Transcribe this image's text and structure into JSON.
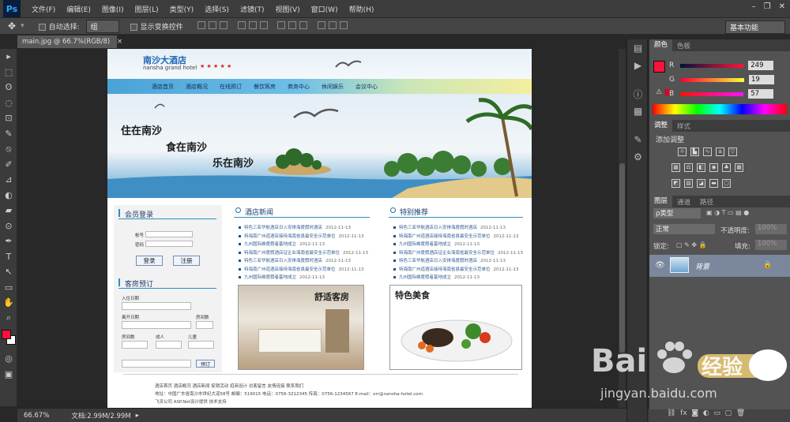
{
  "menubar": {
    "logo": "Ps",
    "items": [
      "文件(F)",
      "编辑(E)",
      "图像(I)",
      "图层(L)",
      "类型(Y)",
      "选择(S)",
      "滤镜(T)",
      "视图(V)",
      "窗口(W)",
      "帮助(H)"
    ],
    "minimize": "–",
    "restore": "❐",
    "close": "✕"
  },
  "options": {
    "tool_icon": "✥",
    "auto_select_label": "自动选择:",
    "auto_select_value": "组",
    "show_transform_label": "显示变换控件",
    "workspace": "基本功能"
  },
  "document": {
    "tab_label": "main.jpg @ 66.7%(RGB/8)",
    "tab_close": "×"
  },
  "status": {
    "zoom": "66.67%",
    "doc_size": "文档:2.99M/2.99M"
  },
  "tools": [
    "▸",
    "⬚",
    "ʘ",
    "◌",
    "⊡",
    "✎",
    "⦸",
    "✐",
    "⊿",
    "◐",
    "▰",
    "⊙",
    "✒",
    "T",
    "↖",
    "▭",
    "✋",
    "⌕"
  ],
  "panels": {
    "color_tab": "颜色",
    "swatches_tab": "色板",
    "r_label": "R",
    "g_label": "G",
    "b_label": "B",
    "r_value": "249",
    "g_value": "19",
    "b_value": "57",
    "foreground_color": "#f91339",
    "adjust_tab": "调整",
    "styles_tab": "样式",
    "add_adjust": "添加调整",
    "layers_tab": "图层",
    "channels_tab": "通道",
    "paths_tab": "路径",
    "kind_label": "ρ类型",
    "blend_mode": "正常",
    "opacity_label": "不透明度:",
    "opacity_value": "100%",
    "lock_label": "锁定:",
    "fill_label": "填充:",
    "fill_value": "100%",
    "layer_name": "背景"
  },
  "hotel": {
    "logo_cn": "南沙大酒店",
    "logo_en": "nansha grand hotel",
    "stars": "★ ★ ★ ★ ★",
    "nav": [
      "酒店首页",
      "酒店概况",
      "在线预订",
      "餐饮客房",
      "商务中心",
      "休闲娱乐",
      "会议中心"
    ],
    "slogan1": "住在南沙",
    "slogan2": "食在南沙",
    "slogan3": "乐在南沙",
    "login_title": "会员登录",
    "account_label": "帐号",
    "password_label": "密码",
    "login_btn": "登录",
    "register_btn": "注册",
    "booking_title": "客房预订",
    "checkin_label": "入住日期",
    "checkout_label": "离开日期",
    "room_count_label": "房间数",
    "room_type_label": "房间数",
    "adult_label": "成人",
    "child_label": "儿童",
    "note_label": "",
    "book_btn": "预订",
    "news_title": "酒店新闻",
    "recommend_title": "特别推荐",
    "news": [
      "特色三亚华航酒店日入安排海度假时酒店",
      "特海南广州道酒店接待海南省县最安全示范单位",
      "九州国际维度假者基地成立",
      "特海南广州度假酒店证企业海南省最安全示范单位",
      "特色三亚华航酒店日入安排海度假时酒店",
      "特海南广州道酒店接待海南省县最安全示范单位",
      "九州国际维度假者基地成立"
    ],
    "recommend": [
      "特色三亚华航酒店日入安排海度假时酒店",
      "特海南广州道酒店接待海南省县最安全示范单位",
      "九州国际维度假者基地成立",
      "特海南广州度假酒店证企业海南省最安全示范单位",
      "特色三亚华航酒店日入安排海度假时酒店",
      "特海南广州道酒店接待海南省县最安全示范单位",
      "九州国际维度假者基地成立"
    ],
    "news_date": "2012-11-13",
    "room_caption": "舒适客房",
    "food_caption": "特色美食",
    "footer1": "酒店首页 酒店概况 酒店新闻 促销活动 招商设计 访客留言 友情连接 联系我们",
    "footer2": "地址：中国广东省南沙市世纪大道58号 邮编：519015 电话：0756-3212345 传真：0756-1234567 E-mail：orr@nansha-hotel.com",
    "footer3": "飞灵公司 ASP.Net设计提供 技术支持"
  },
  "watermark": {
    "brand": "Bai",
    "brand2": "经验",
    "url": "jingyan.baidu.com"
  }
}
